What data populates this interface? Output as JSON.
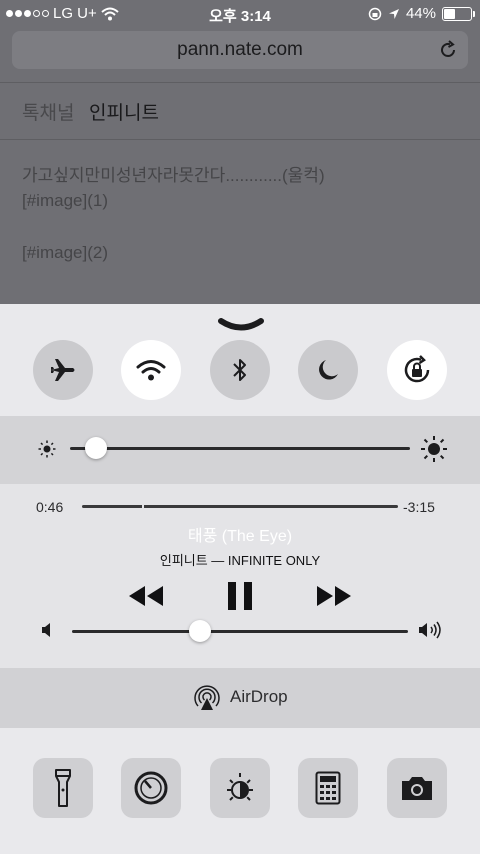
{
  "status_bar": {
    "carrier": "LG U+",
    "time": "오후 3:14",
    "battery_percent": "44%",
    "battery_level": 0.44,
    "signal_bars": 3
  },
  "browser": {
    "url": "pann.nate.com",
    "breadcrumb": [
      "톡채널",
      "인피니트"
    ],
    "content_lines": [
      "가고싶지만미성년자라못간다............(울컥)",
      "[#image](1)",
      "[#image](2)"
    ]
  },
  "control_center": {
    "toggles": [
      {
        "name": "airplane-mode",
        "icon": "airplane-icon",
        "on": false
      },
      {
        "name": "wifi",
        "icon": "wifi-icon",
        "on": true
      },
      {
        "name": "bluetooth",
        "icon": "bluetooth-icon",
        "on": false
      },
      {
        "name": "do-not-disturb",
        "icon": "moon-icon",
        "on": false
      },
      {
        "name": "rotation-lock",
        "icon": "rotation-lock-icon",
        "on": true
      }
    ],
    "brightness_level": 0.05,
    "music": {
      "elapsed": "0:46",
      "remaining": "-3:15",
      "progress": 0.19,
      "title": "태풍 (The Eye)",
      "artist_album": "인피니트 — INFINITE ONLY",
      "volume_level": 0.38
    },
    "airdrop_label": "AirDrop",
    "shortcuts": [
      "flashlight-icon",
      "timer-icon",
      "night-shift-icon",
      "calculator-icon",
      "camera-icon"
    ]
  }
}
